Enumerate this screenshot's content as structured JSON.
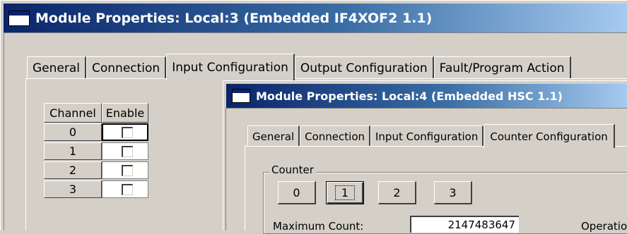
{
  "window1": {
    "title": "Module Properties: Local:3 (Embedded IF4XOF2 1.1)",
    "tabs": [
      {
        "label": "General"
      },
      {
        "label": "Connection"
      },
      {
        "label": "Input Configuration",
        "active": true
      },
      {
        "label": "Output Configuration"
      },
      {
        "label": "Fault/Program Action"
      }
    ],
    "channel_table": {
      "headers": [
        "Channel",
        "Enable"
      ],
      "rows": [
        {
          "channel": "0",
          "enabled": false
        },
        {
          "channel": "1",
          "enabled": false
        },
        {
          "channel": "2",
          "enabled": false
        },
        {
          "channel": "3",
          "enabled": false
        }
      ]
    }
  },
  "window2": {
    "title": "Module Properties: Local:4 (Embedded HSC 1.1)",
    "tabs": [
      {
        "label": "General"
      },
      {
        "label": "Connection"
      },
      {
        "label": "Input Configuration"
      },
      {
        "label": "Counter Configuration",
        "active": true
      }
    ],
    "counter_group": {
      "label": "Counter",
      "buttons": [
        "0",
        "1",
        "2",
        "3"
      ],
      "selected": "1"
    },
    "max_count": {
      "label": "Maximum Count:",
      "value": "2147483647"
    },
    "operation_label": "Operation"
  },
  "colors": {
    "title_start": "#0a246a",
    "title_end": "#a6caf0",
    "face": "#d4d0c8"
  }
}
